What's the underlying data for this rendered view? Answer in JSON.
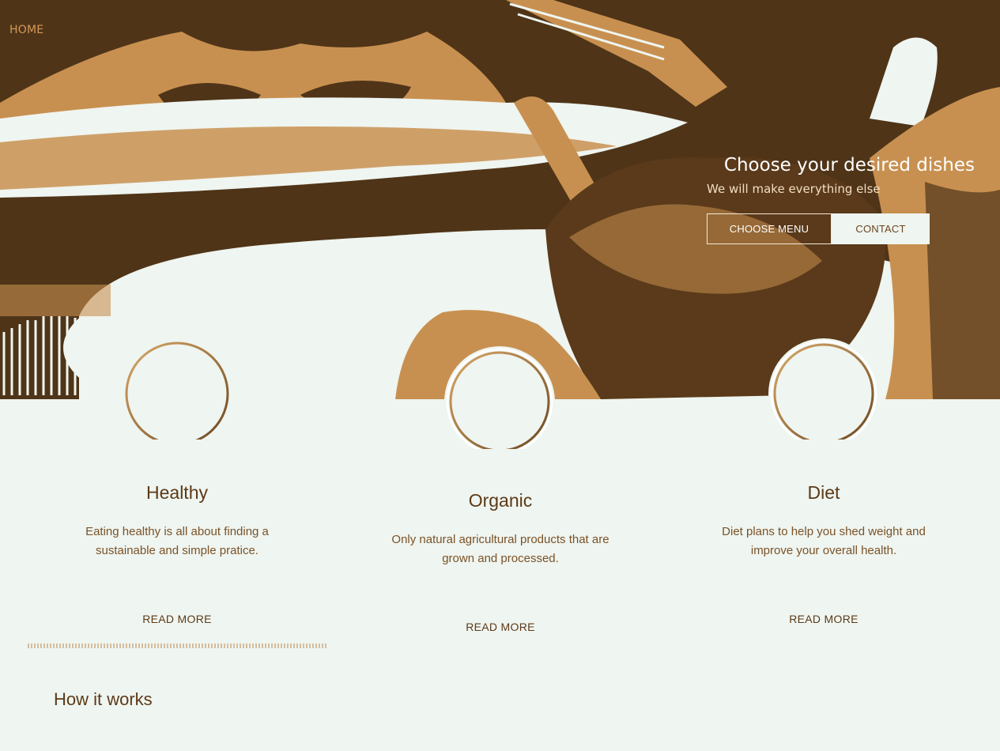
{
  "nav": {
    "home_label": "HOME"
  },
  "hero": {
    "title": "Choose your desired dishes",
    "subtitle": "We will make everything else",
    "choose_menu_label": "CHOOSE MENU",
    "contact_label": "CONTACT"
  },
  "features": [
    {
      "title": "Healthy",
      "description": "Eating healthy is all about finding a sustainable and simple pratice.",
      "link_label": "READ MORE"
    },
    {
      "title": "Organic",
      "description": "Only natural agricultural products that are grown and processed.",
      "link_label": "READ MORE"
    },
    {
      "title": "Diet",
      "description": "Diet plans to help you shed weight and improve your overall health.",
      "link_label": "READ MORE"
    }
  ],
  "section": {
    "how_it_works": "How it works"
  },
  "colors": {
    "dark_brown": "#4f3418",
    "tan": "#c89050",
    "cream": "#eff5f0"
  }
}
